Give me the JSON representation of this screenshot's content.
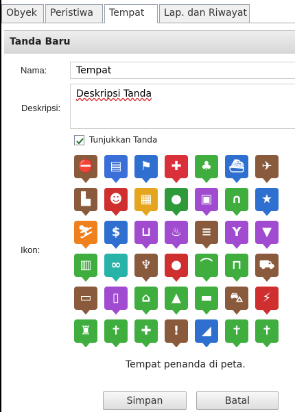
{
  "tabs": [
    {
      "label": "Obyek",
      "active": false
    },
    {
      "label": "Peristiwa",
      "active": false
    },
    {
      "label": "Tempat",
      "active": true
    },
    {
      "label": "Lap. dan Riwayat",
      "active": false
    }
  ],
  "header": {
    "title": "Tanda Baru"
  },
  "form": {
    "name_label": "Nama:",
    "name_value": "Tempat",
    "description_label": "Deskripsi:",
    "description_value": "Deskripsi Tanda",
    "show_marker_label": "Tunjukkan Tanda",
    "show_marker_checked": true,
    "icon_label": "Ikon:"
  },
  "icons": [
    [
      {
        "name": "no-entry-icon",
        "glyph": "⛔",
        "color": "#8a5a3c"
      },
      {
        "name": "document-icon",
        "glyph": "▤",
        "color": "#3a6fd8"
      },
      {
        "name": "signpost-icon",
        "glyph": "⚑",
        "color": "#2f6fd0"
      },
      {
        "name": "first-aid-icon",
        "glyph": "✚",
        "color": "#d9303a"
      },
      {
        "name": "tree-icon",
        "glyph": "♣",
        "color": "#3fae3f"
      },
      {
        "name": "ship-icon",
        "glyph": "⛴",
        "color": "#2f6fd0"
      },
      {
        "name": "airplane-icon",
        "glyph": "✈",
        "color": "#8a5a3c"
      }
    ],
    [
      {
        "name": "factory-icon",
        "glyph": "▙",
        "color": "#8a5a3c"
      },
      {
        "name": "alien-icon",
        "glyph": "☻",
        "color": "#cf2f2f"
      },
      {
        "name": "building-icon",
        "glyph": "▦",
        "color": "#e6a51e"
      },
      {
        "name": "apple-icon",
        "glyph": "●",
        "color": "#2f9a3a"
      },
      {
        "name": "picture-icon",
        "glyph": "▣",
        "color": "#a04bd0"
      },
      {
        "name": "arch-icon",
        "glyph": "∩",
        "color": "#3fae3f"
      },
      {
        "name": "military-icon",
        "glyph": "★",
        "color": "#2f6fd0"
      }
    ],
    [
      {
        "name": "skiing-icon",
        "glyph": "⛷",
        "color": "#f07f1e"
      },
      {
        "name": "money-bag-icon",
        "glyph": "$",
        "color": "#2f6fd0"
      },
      {
        "name": "beer-icon",
        "glyph": "⊔",
        "color": "#a04bd0"
      },
      {
        "name": "barbecue-icon",
        "glyph": "♨",
        "color": "#a04bd0"
      },
      {
        "name": "bridge-icon",
        "glyph": "≡",
        "color": "#8a5a3c"
      },
      {
        "name": "bar-icon",
        "glyph": "Y",
        "color": "#a04bd0"
      },
      {
        "name": "blender-icon",
        "glyph": "▼",
        "color": "#a04bd0"
      }
    ],
    [
      {
        "name": "city-icon",
        "glyph": "▥",
        "color": "#3fae3f"
      },
      {
        "name": "binoculars-icon",
        "glyph": "∞",
        "color": "#27b3a8"
      },
      {
        "name": "trophy-icon",
        "glyph": "♆",
        "color": "#8a5a3c"
      },
      {
        "name": "bomb-icon",
        "glyph": "●",
        "color": "#cf2f2f"
      },
      {
        "name": "bridge-arch-icon",
        "glyph": "⌒",
        "color": "#3fae3f"
      },
      {
        "name": "aqueduct-icon",
        "glyph": "⊓",
        "color": "#3fae3f"
      },
      {
        "name": "bulldozer-icon",
        "glyph": "⛟",
        "color": "#8a5a3c"
      }
    ],
    [
      {
        "name": "bus-icon",
        "glyph": "▭",
        "color": "#8a5a3c"
      },
      {
        "name": "bus-stop-icon",
        "glyph": "▯",
        "color": "#a04bd0"
      },
      {
        "name": "cabin-icon",
        "glyph": "⌂",
        "color": "#3fae3f"
      },
      {
        "name": "campfire-icon",
        "glyph": "▲",
        "color": "#3fae3f"
      },
      {
        "name": "camper-icon",
        "glyph": "▬",
        "color": "#3fae3f"
      },
      {
        "name": "car-icon",
        "glyph": "⛍",
        "color": "#8a5a3c"
      },
      {
        "name": "car-crash-icon",
        "glyph": "⚡",
        "color": "#cf2f2f"
      }
    ],
    [
      {
        "name": "castle-icon",
        "glyph": "♜",
        "color": "#3fae3f"
      },
      {
        "name": "cathedral-icon",
        "glyph": "✝",
        "color": "#3fae3f"
      },
      {
        "name": "cemetery-icon",
        "glyph": "✚",
        "color": "#3fae3f"
      },
      {
        "name": "caution-icon",
        "glyph": "!",
        "color": "#8a5a3c"
      },
      {
        "name": "chart-up-icon",
        "glyph": "◢",
        "color": "#2f6fd0"
      },
      {
        "name": "church-icon",
        "glyph": "✝",
        "color": "#3fae3f"
      },
      {
        "name": "church-2-icon",
        "glyph": "✝",
        "color": "#3fae3f"
      }
    ]
  ],
  "status_text": "Tempat penanda di peta.",
  "buttons": {
    "save": "Simpan",
    "cancel": "Batal"
  }
}
